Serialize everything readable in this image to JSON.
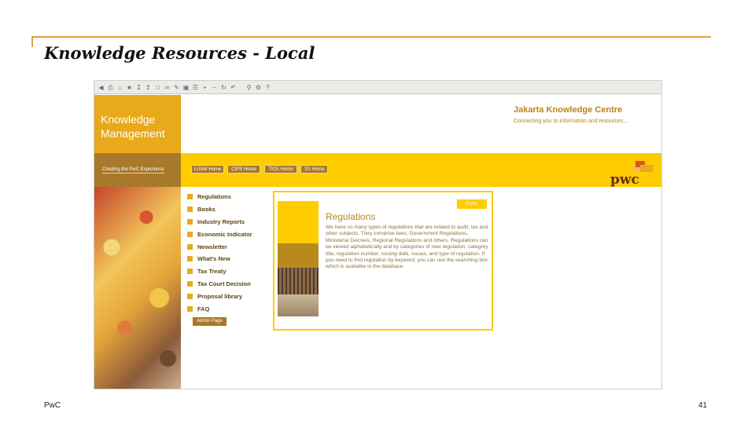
{
  "slide": {
    "title": "Knowledge Resources - Local",
    "footer_left": "PwC",
    "page_number": "41",
    "accent_color": "#d9a441"
  },
  "browser": {
    "toolbar_icons": [
      "back-icon",
      "print-icon",
      "home-icon",
      "bookmark-icon",
      "download-icon",
      "up-icon",
      "folder-icon",
      "link-icon",
      "edit-icon",
      "save-icon",
      "list-icon",
      "add-icon",
      "minus-icon",
      "refresh-icon",
      "undo-icon",
      "zoom-icon",
      "settings-icon",
      "help-icon"
    ]
  },
  "site": {
    "km_title": "Knowledge Management",
    "tagline": "Creating the PwC Experience",
    "centre_title": "Jakarta Knowledge Centre",
    "centre_subtitle": "Connecting you to information and resources...",
    "logo_text": "pwc",
    "nav_buttons": [
      "LUAW Home",
      "CIPS Home",
      "TICE Home",
      "TG Home"
    ],
    "menu": [
      "Regulations",
      "Books",
      "Industry Reports",
      "Economic Indicator",
      "Newsletter",
      "What's New",
      "Tax Treaty",
      "Tax Court Decision",
      "Proposal library",
      "FAQ"
    ],
    "admin_button": "Admin Page",
    "colors": {
      "yellow": "#ffcc00",
      "gold": "#e8a91a",
      "brown": "#a8792a"
    }
  },
  "feature": {
    "enter_button": "Enter",
    "heading": "Regulations",
    "body": "We have so many types of regulations that are related to audit, tax and other subjects. They comprise laws, Government Regulations, Ministerial Decrees, Regional Regulations and others. Regulations can be viewed alphabetically and by categories of new regulation, category, title, regulation number, issuing date, issues, and type of regulation. If you need to find regulation by keyword, you can use the searching box which is available in the database."
  }
}
